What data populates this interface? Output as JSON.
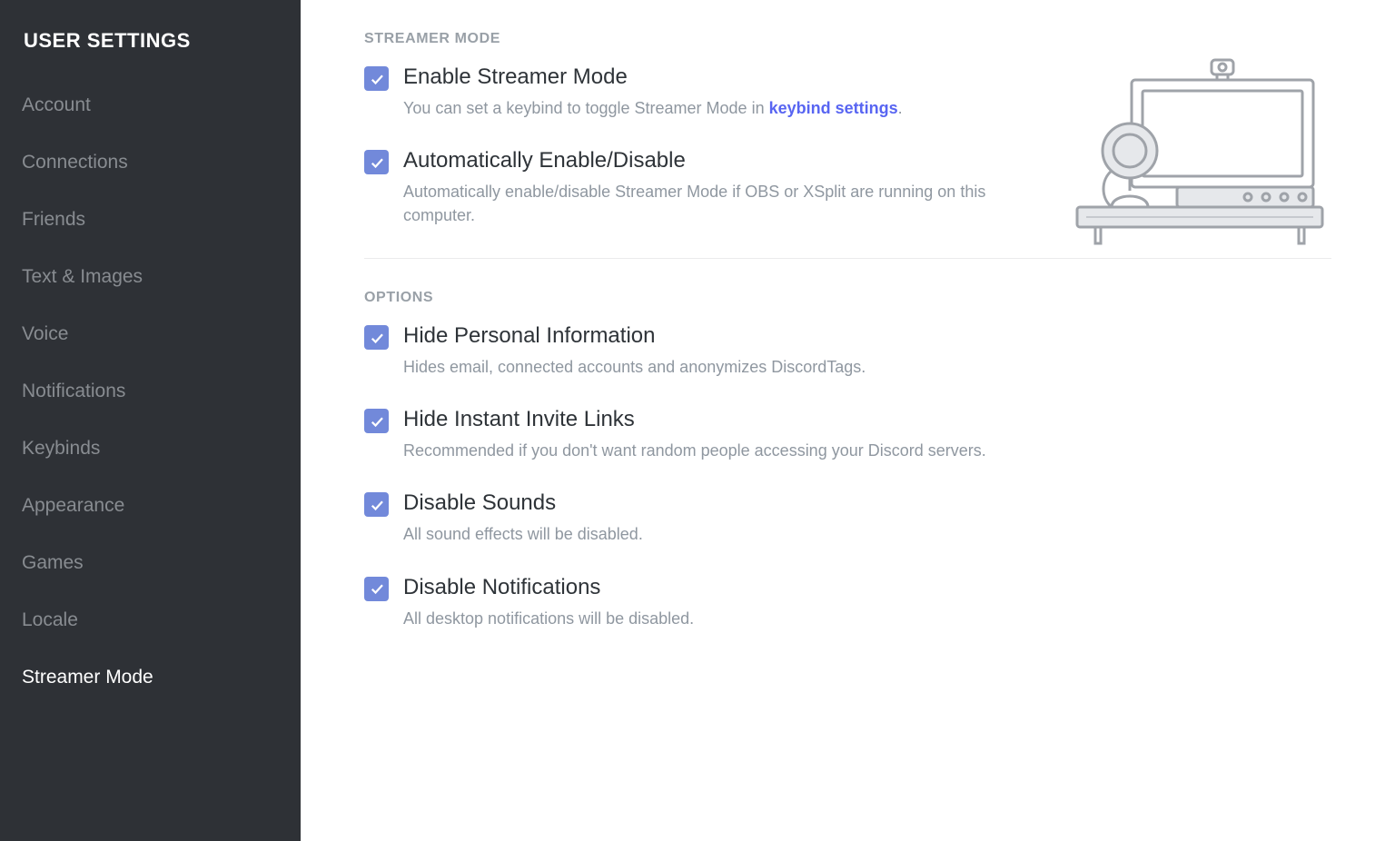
{
  "sidebar": {
    "title": "User Settings",
    "items": [
      {
        "label": "Account",
        "active": false
      },
      {
        "label": "Connections",
        "active": false
      },
      {
        "label": "Friends",
        "active": false
      },
      {
        "label": "Text & Images",
        "active": false
      },
      {
        "label": "Voice",
        "active": false
      },
      {
        "label": "Notifications",
        "active": false
      },
      {
        "label": "Keybinds",
        "active": false
      },
      {
        "label": "Appearance",
        "active": false
      },
      {
        "label": "Games",
        "active": false
      },
      {
        "label": "Locale",
        "active": false
      },
      {
        "label": "Streamer Mode",
        "active": true
      }
    ]
  },
  "sections": {
    "streamer_heading": "Streamer Mode",
    "options_heading": "Options"
  },
  "settings": {
    "enable": {
      "title": "Enable Streamer Mode",
      "desc_pre": "You can set a keybind to toggle Streamer Mode in ",
      "desc_link": "keybind settings",
      "desc_post": ".",
      "checked": true
    },
    "auto": {
      "title": "Automatically Enable/Disable",
      "desc": "Automatically enable/disable Streamer Mode if OBS or XSplit are running on this computer.",
      "checked": true
    },
    "hide_personal": {
      "title": "Hide Personal Information",
      "desc": "Hides email, connected accounts and anonymizes DiscordTags.",
      "checked": true
    },
    "hide_invite": {
      "title": "Hide Instant Invite Links",
      "desc": "Recommended if you don't want random people accessing your Discord servers.",
      "checked": true
    },
    "disable_sounds": {
      "title": "Disable Sounds",
      "desc": "All sound effects will be disabled.",
      "checked": true
    },
    "disable_notifications": {
      "title": "Disable Notifications",
      "desc": "All desktop notifications will be disabled.",
      "checked": true
    }
  },
  "colors": {
    "sidebar_bg": "#2e3136",
    "accent": "#7289da",
    "link": "#5865f2",
    "text": "#2e3338",
    "muted": "#8f97a0"
  }
}
